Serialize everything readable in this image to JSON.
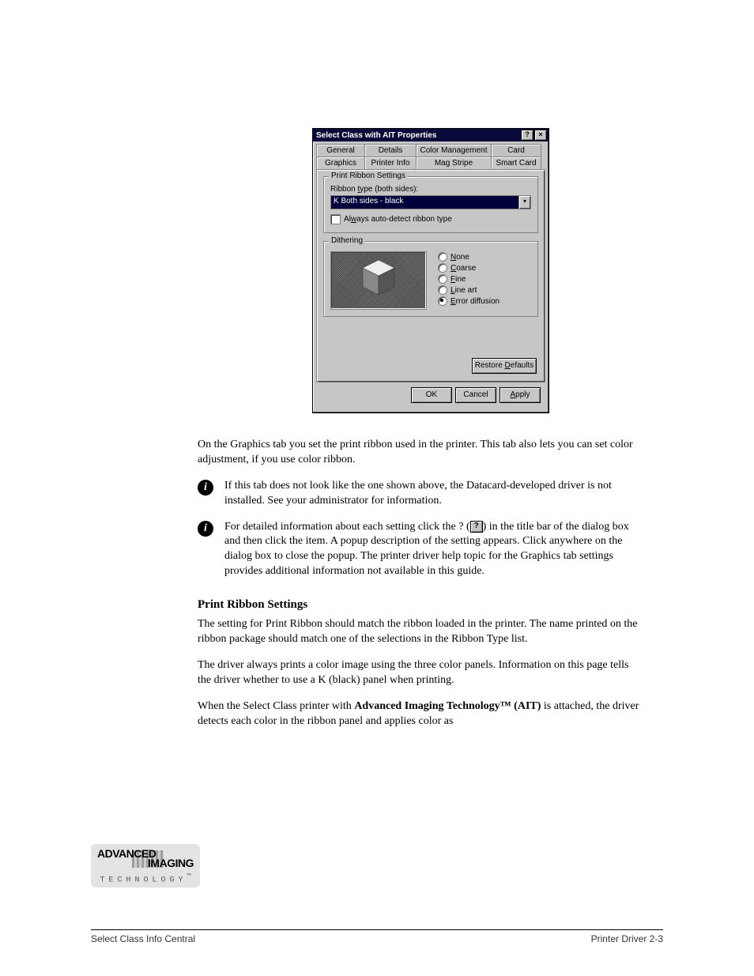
{
  "dialog": {
    "title": "Select Class with AIT Properties",
    "tabs_back": [
      "General",
      "Details",
      "Color Management",
      "Card"
    ],
    "tabs_front": [
      "Graphics",
      "Printer Info",
      "Mag Stripe",
      "Smart Card"
    ],
    "active_tab": "Graphics",
    "ribbon_group_title": "Print Ribbon Settings",
    "ribbon_label": "Ribbon type (both sides):",
    "ribbon_selected": "K Both sides - black",
    "auto_detect_label": "Always auto-detect ribbon type",
    "auto_detect_checked": false,
    "dither_group_title": "Dithering",
    "dither_options": [
      {
        "label_pre": "",
        "accel": "N",
        "label_post": "one",
        "selected": false
      },
      {
        "label_pre": "",
        "accel": "C",
        "label_post": "oarse",
        "selected": false
      },
      {
        "label_pre": "",
        "accel": "F",
        "label_post": "ine",
        "selected": false
      },
      {
        "label_pre": "",
        "accel": "L",
        "label_post": "ine art",
        "selected": false
      },
      {
        "label_pre": "",
        "accel": "E",
        "label_post": "rror diffusion",
        "selected": true
      }
    ],
    "restore_label_pre": "Restore ",
    "restore_accel": "D",
    "restore_label_post": "efaults",
    "ok": "OK",
    "cancel": "Cancel",
    "apply": "Apply"
  },
  "doc": {
    "para1": "On the Graphics tab you set the print ribbon used in the printer. This tab also lets you can set color adjustment, if you use color ribbon.",
    "note1": "If this tab does not look like the one shown above, the Datacard-developed driver is not installed. See your administrator for information.",
    "note2_pre": "For detailed information about each setting click the ? (",
    "note2_post": ") in the title bar of the dialog box and then click the item. A popup description of the setting appears. Click anywhere on the dialog box to close the popup. The printer driver help topic for the Graphics tab settings provides additional information not available in this guide.",
    "h_ribbon": "Print Ribbon Settings",
    "ribbon_p1": "The setting for Print Ribbon should match the ribbon loaded in the printer. The name printed on the ribbon package should match one of the selections in the Ribbon Type list.",
    "ribbon_p2": "The driver always prints a color image using the three color panels. Information on this page tells the driver whether to use a K (black) panel when printing.",
    "ribbon_p3_a": "When the Select Class printer with ",
    "ribbon_p3_b": " detects each color in the ribbon panel and applies color as",
    "ait_b": "Advanced Imaging Technology™ (AIT)",
    "ait_c": " is attached, the driver",
    "footer_left": "Select Class Info Central",
    "footer_right": "Printer Driver 2-3"
  },
  "logo": {
    "advanced": "ADVANCED",
    "imaging": "IMAGING",
    "technology": "TECHNOLOGY",
    "tm": "™"
  }
}
